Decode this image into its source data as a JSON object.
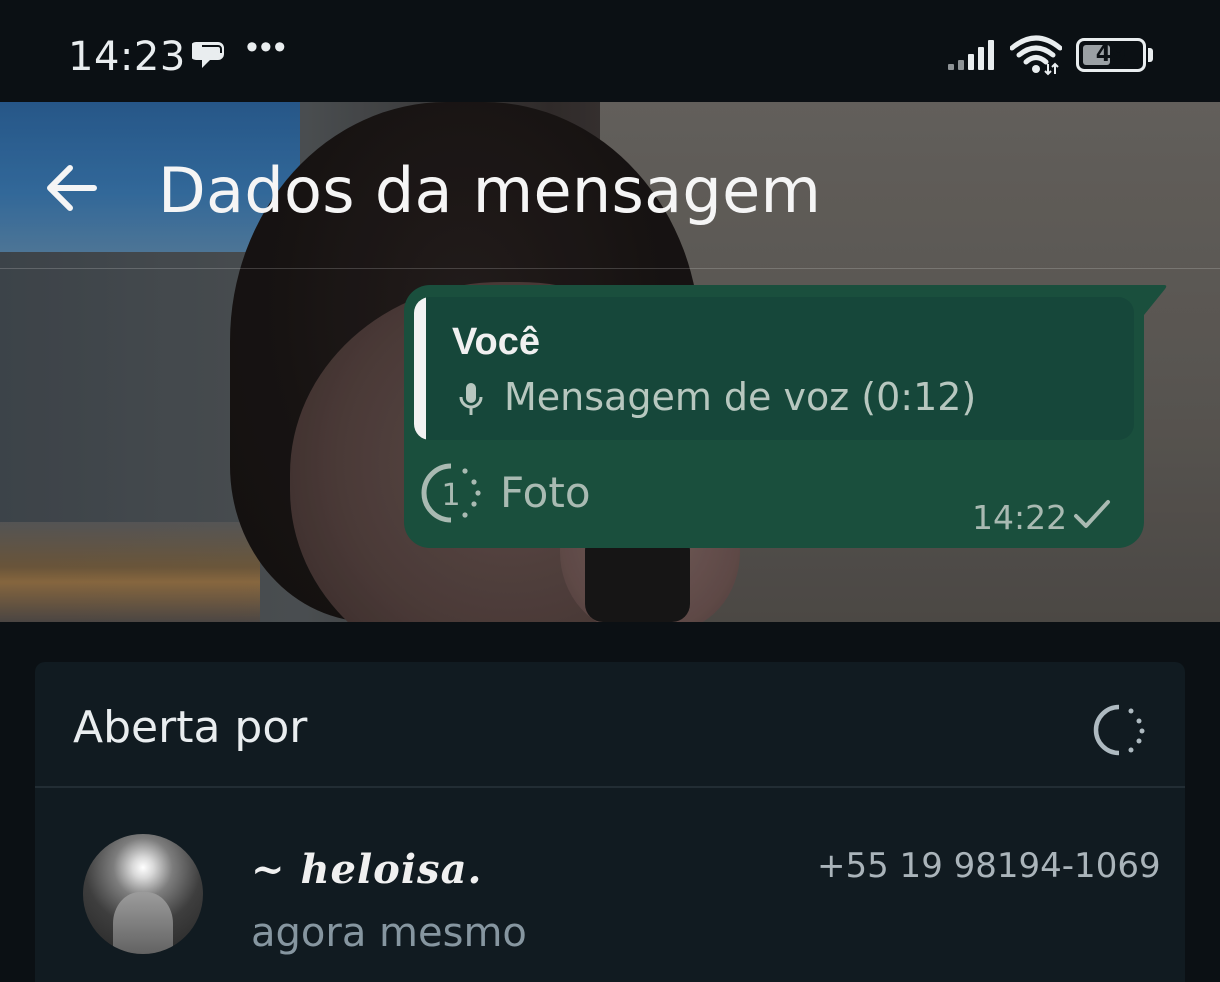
{
  "status_bar": {
    "time": "14:23",
    "more_label": "•••",
    "battery_level": "49",
    "battery_percent": 49,
    "icons": [
      "chat-bubbles-icon",
      "cellular-signal-icon",
      "wifi-icon",
      "battery-icon"
    ]
  },
  "header": {
    "title": "Dados da mensagem",
    "back_icon": "arrow-left-icon"
  },
  "message": {
    "quoted_author": "Você",
    "quoted_text": "Mensagem de voz (0:12)",
    "quoted_icon": "microphone-icon",
    "media_label": "Foto",
    "media_icon": "view-once-icon",
    "time": "14:22",
    "status_icon": "single-check-icon",
    "bubble_color": "#1a4f3d",
    "quote_color": "#16473a"
  },
  "read_by": {
    "title": "Aberta por",
    "title_icon": "view-once-icon",
    "contacts": [
      {
        "name": "~ heloisa.",
        "status": "agora mesmo",
        "phone": "+55 19 98194-1069"
      }
    ]
  },
  "colors": {
    "background": "#0b1014",
    "card": "#111b21",
    "secondary_text": "#8696a0"
  }
}
